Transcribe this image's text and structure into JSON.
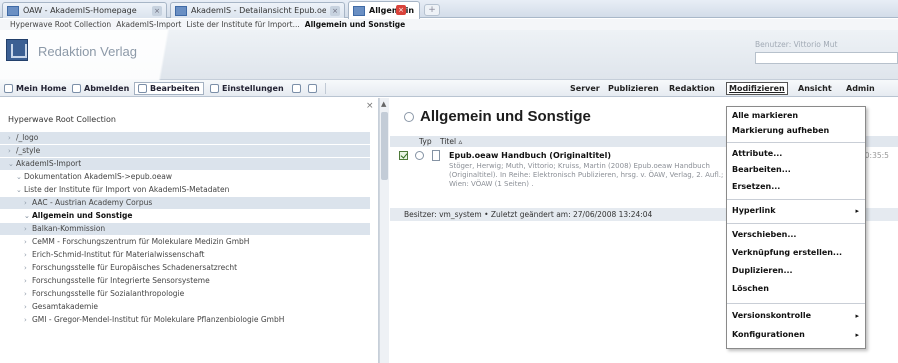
{
  "browser": {
    "tabs": [
      {
        "label": "ÖAW - AkademIS-Homepage",
        "active": false
      },
      {
        "label": "AkademIS - Detailansicht Epub.oeaw H...",
        "active": false
      },
      {
        "label": "Allgemein und Sonstige",
        "active": true
      }
    ],
    "new_tab_label": "+"
  },
  "breadcrumb": {
    "items": [
      "Hyperwave Root Collection",
      "AkademIS-Import",
      "Liste der Institute für Import...",
      "Allgemein und Sonstige"
    ]
  },
  "header": {
    "brand": "Redaktion Verlag",
    "user_label": "Benutzer: Vittorio Mut"
  },
  "toolbar": {
    "mein_home": "Mein Home",
    "abmelden": "Abmelden",
    "bearbeiten": "Bearbeiten",
    "einstellungen": "Einstellungen",
    "menus": [
      "Server",
      "Publizieren",
      "Redaktion",
      "Modifizieren",
      "Ansicht",
      "Admin"
    ]
  },
  "tree": {
    "root": "Hyperwave Root Collection",
    "rows": [
      {
        "label": "/_logo",
        "toggle": "›",
        "shade": true
      },
      {
        "label": "/_style",
        "toggle": "›",
        "shade": true
      },
      {
        "label": "AkademIS-Import",
        "toggle": "⌄",
        "shade": true
      },
      {
        "label": "Dokumentation AkademIS->epub.oeaw",
        "toggle": "⌄"
      },
      {
        "label": "Liste der Institute für Import von AkademIS-Metadaten",
        "toggle": "⌄"
      },
      {
        "label": "AAC - Austrian Academy Corpus",
        "toggle": "›",
        "shade": true
      },
      {
        "label": "Allgemein und Sonstige",
        "toggle": "⌄",
        "bold": true
      },
      {
        "label": "Balkan-Kommission",
        "toggle": "›",
        "shade": true
      },
      {
        "label": "CeMM - Forschungszentrum für Molekulare Medizin GmbH",
        "toggle": "›"
      },
      {
        "label": "Erich-Schmid-Institut für Materialwissenschaft",
        "toggle": "›"
      },
      {
        "label": "Forschungsstelle für Europäisches Schadenersatzrecht",
        "toggle": "›"
      },
      {
        "label": "Forschungsstelle für Integrierte Sensorsysteme",
        "toggle": "›"
      },
      {
        "label": "Forschungsstelle für Sozialanthropologie",
        "toggle": "›"
      },
      {
        "label": "Gesamtakademie",
        "toggle": "›"
      },
      {
        "label": "GMI - Gregor-Mendel-Institut für Molekulare Pflanzenbiologie GmbH",
        "toggle": "›"
      }
    ]
  },
  "main": {
    "title": "Allgemein und Sonstige",
    "columns": {
      "typ": "Typ",
      "titel": "Titel ▵"
    },
    "entry": {
      "title": "Epub.oeaw Handbuch (Originaltitel)",
      "description": "Stöger, Herwig; Muth, Vittorio; Kruiss, Martin (2008) Epub.oeaw Handbuch (Originaltitel). In Reihe: Elektronisch Publizieren, hrsg. v. ÖAW, Verlag, 2. Aufl.; Wien: VÖAW (1 Seiten) .",
      "time": "10:35:5"
    },
    "owner": "Besitzer: vm_system • Zuletzt geändert am: 27/06/2008 13:24:04"
  },
  "menu": {
    "items": [
      {
        "label": "Alle markieren",
        "arrow": ""
      },
      {
        "label": "Markierung aufheben",
        "arrow": ""
      },
      {
        "label": "Attribute...",
        "arrow": ""
      },
      {
        "label": "Bearbeiten...",
        "arrow": ""
      },
      {
        "label": "Ersetzen...",
        "arrow": ""
      },
      {
        "label": "Hyperlink",
        "arrow": "▸"
      },
      {
        "label": "Verschieben...",
        "arrow": ""
      },
      {
        "label": "Verknüpfung erstellen...",
        "arrow": ""
      },
      {
        "label": "Duplizieren...",
        "arrow": ""
      },
      {
        "label": "Löschen",
        "arrow": ""
      },
      {
        "label": "Versionskontrolle",
        "arrow": "▸"
      },
      {
        "label": "Konfigurationen",
        "arrow": "▸"
      }
    ]
  }
}
